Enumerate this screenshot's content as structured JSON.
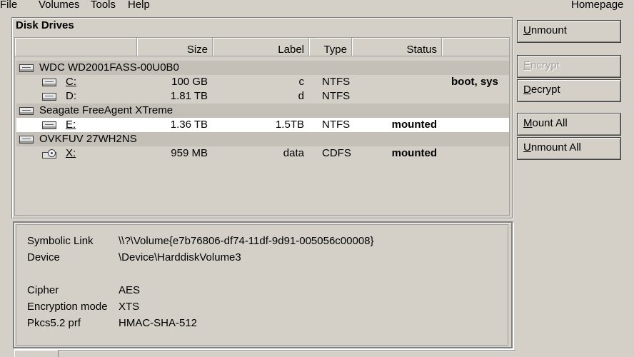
{
  "menu": {
    "file": "File",
    "volumes": "Volumes",
    "tools": "Tools",
    "help": "Help",
    "homepage": "Homepage"
  },
  "drives": {
    "title": "Disk Drives",
    "columns": {
      "size": "Size",
      "label": "Label",
      "type": "Type",
      "status": "Status"
    },
    "groups": [
      {
        "name": "WDC WD2001FASS-00U0B0"
      },
      {
        "name": "Seagate FreeAgent XTreme"
      },
      {
        "name": "OVKFUV 27WH2NS"
      }
    ],
    "volumes": [
      {
        "letter": "C:",
        "size": "100 GB",
        "label": "c",
        "type": "NTFS",
        "status": "",
        "extra": "boot, sys"
      },
      {
        "letter": "D:",
        "size": "1.81 TB",
        "label": "d",
        "type": "NTFS",
        "status": "",
        "extra": ""
      },
      {
        "letter": "E:",
        "size": "1.36 TB",
        "label": "1.5TB",
        "type": "NTFS",
        "status": "mounted",
        "extra": ""
      },
      {
        "letter": "X:",
        "size": "959 MB",
        "label": "data",
        "type": "CDFS",
        "status": "mounted",
        "extra": ""
      }
    ]
  },
  "details": {
    "symbolic_link_label": "Symbolic Link",
    "symbolic_link_value": "\\\\?\\Volume{e7b76806-df74-11df-9d91-005056c00008}",
    "device_label": "Device",
    "device_value": "\\Device\\HarddiskVolume3",
    "cipher_label": "Cipher",
    "cipher_value": "AES",
    "mode_label": "Encryption mode",
    "mode_value": "XTS",
    "prf_label": "Pkcs5.2 prf",
    "prf_value": "HMAC-SHA-512"
  },
  "buttons": {
    "unmount_first": "U",
    "unmount_rest": "nmount",
    "encrypt_first": "E",
    "encrypt_rest": "ncrypt",
    "decrypt_first": "D",
    "decrypt_rest": "ecrypt",
    "mount_all_first": "M",
    "mount_all_rest": "ount All",
    "unmount_all_first": "U",
    "unmount_all_rest": "nmount All"
  }
}
